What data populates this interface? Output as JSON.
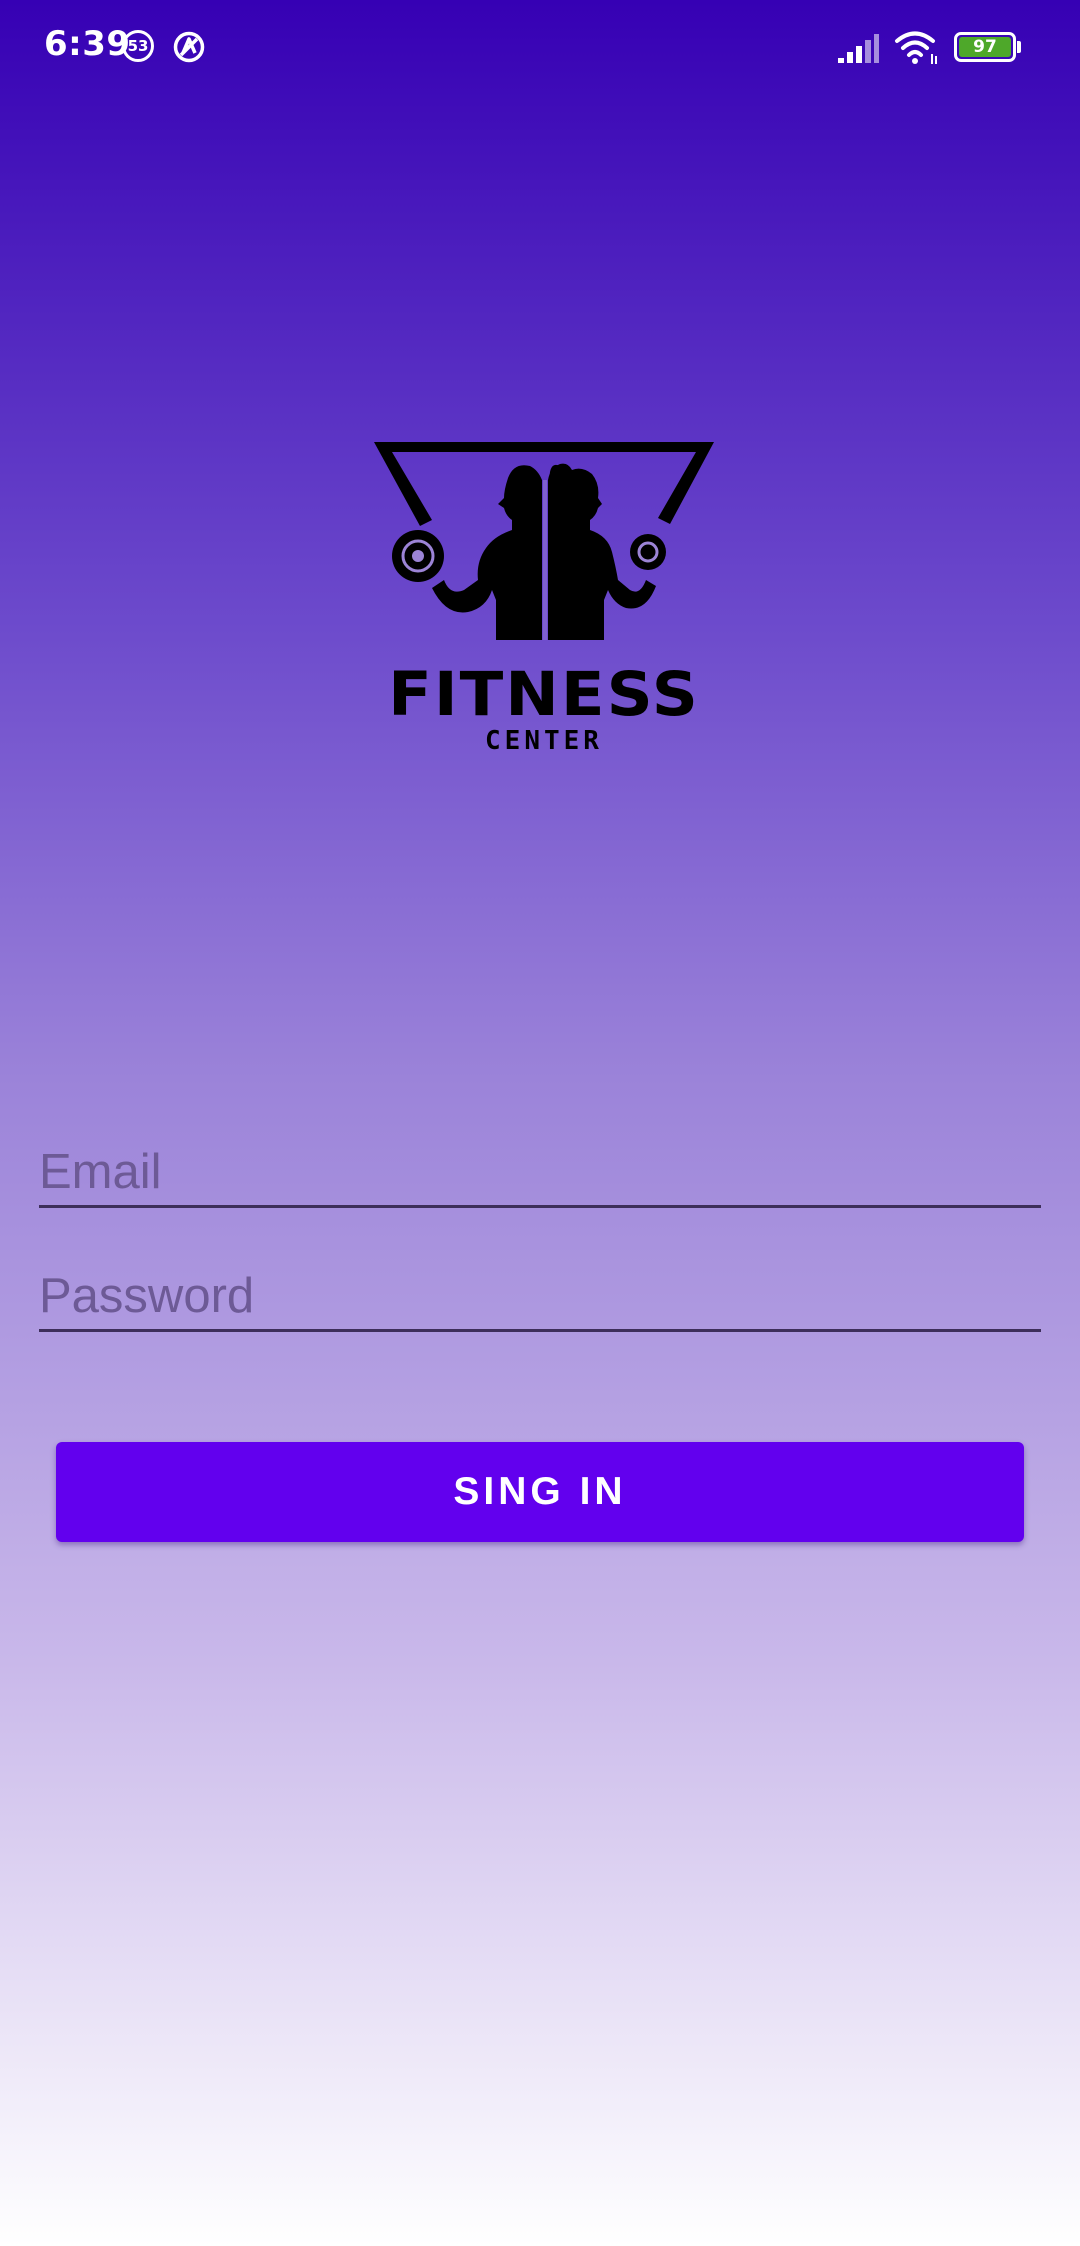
{
  "status_bar": {
    "time": "6:39",
    "notification_count": "53",
    "battery_level": "97",
    "icons": [
      "notification-count-icon",
      "blocked-app-icon",
      "signal-icon",
      "wifi-icon",
      "battery-icon"
    ]
  },
  "logo": {
    "title": "FITNESS",
    "subtitle": "CENTER"
  },
  "form": {
    "email_placeholder": "Email",
    "email_value": "",
    "password_placeholder": "Password",
    "password_value": "",
    "signin_label": "SING IN"
  },
  "colors": {
    "gradient_top": "#3600b4",
    "gradient_bottom": "#ffffff",
    "button": "#6200ee",
    "battery": "#4ea82a"
  }
}
